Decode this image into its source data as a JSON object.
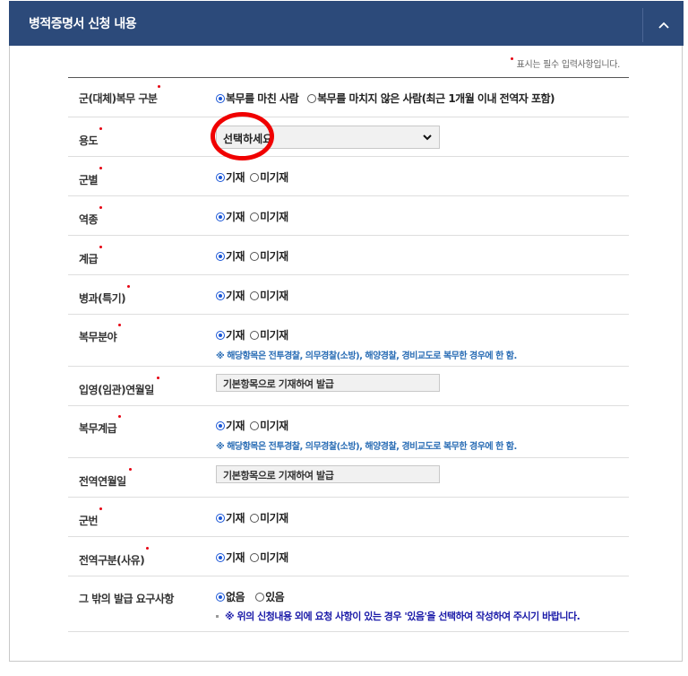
{
  "header": {
    "title": "병적증명서 신청 내용",
    "toggle_icon": "chevron-up-icon"
  },
  "required_note": "표시는 필수 입력사항입니다.",
  "colors": {
    "header_bg": "#2c4a7a",
    "required_dot": "#e60012",
    "radio_selected": "#1a56d6",
    "note_blue": "#2a6db5",
    "note_navy": "#1a1aa8",
    "annotation": "#f00000"
  },
  "form": {
    "service_type": {
      "label": "군(대체)복무 구분",
      "options": [
        "복무를 마친 사람",
        "복무를 마치지 않은 사람(최근 1개월 이내 전역자 포함)"
      ],
      "selected": 0
    },
    "purpose": {
      "label": "용도",
      "value": "선택하세요"
    },
    "branch": {
      "label": "군별",
      "options": [
        "기재",
        "미기재"
      ],
      "selected": 0
    },
    "corps": {
      "label": "역종",
      "options": [
        "기재",
        "미기재"
      ],
      "selected": 0
    },
    "rank": {
      "label": "계급",
      "options": [
        "기재",
        "미기재"
      ],
      "selected": 0
    },
    "specialty": {
      "label": "병과(특기)",
      "options": [
        "기재",
        "미기재"
      ],
      "selected": 0
    },
    "service_field": {
      "label": "복무분야",
      "options": [
        "기재",
        "미기재"
      ],
      "selected": 0,
      "note": "※ 해당항목은 전투경찰, 의무경찰(소방), 해양경찰, 경비교도로 복무한 경우에 한 함."
    },
    "enlist_date": {
      "label": "입영(임관)연월일",
      "value": "기본항목으로 기재하여 발급"
    },
    "service_rank": {
      "label": "복무계급",
      "options": [
        "기재",
        "미기재"
      ],
      "selected": 0,
      "note": "※ 해당항목은 전투경찰, 의무경찰(소방), 해양경찰, 경비교도로 복무한 경우에 한 함."
    },
    "discharge_date": {
      "label": "전역연월일",
      "value": "기본항목으로 기재하여 발급"
    },
    "service_number": {
      "label": "군번",
      "options": [
        "기재",
        "미기재"
      ],
      "selected": 0
    },
    "discharge_reason": {
      "label": "전역구분(사유)",
      "options": [
        "기재",
        "미기재"
      ],
      "selected": 0
    },
    "other_requests": {
      "label": "그 밖의 발급 요구사항",
      "options": [
        "없음",
        "있음"
      ],
      "selected": 0,
      "note": "※ 위의 신청내용 외에 요청 사항이 있는 경우 '있음'을 선택하여 작성하여 주시기 바랍니다."
    }
  }
}
